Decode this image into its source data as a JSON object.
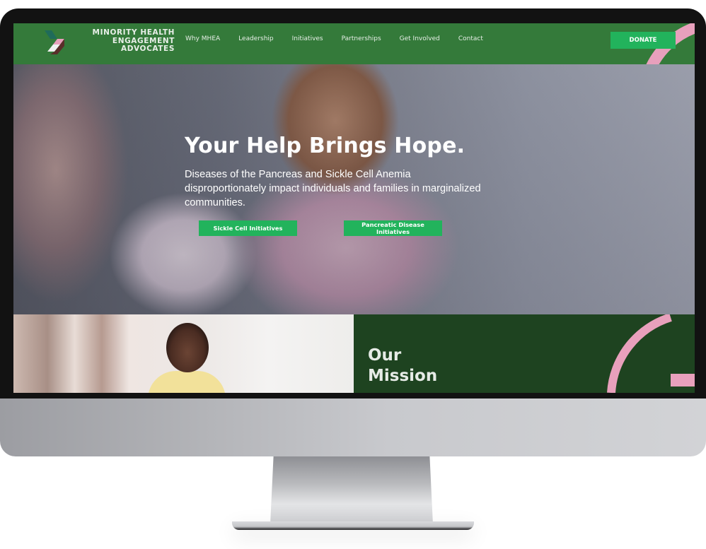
{
  "site": {
    "logo": {
      "line1": "MINORITY HEALTH",
      "line2": "ENGAGEMENT",
      "line3": "ADVOCATES"
    },
    "nav": {
      "links": [
        "Why MHEA",
        "Leadership",
        "Initiatives",
        "Partnerships",
        "Get Involved",
        "Contact"
      ],
      "donate_label": "DONATE"
    },
    "hero": {
      "title": "Your Help Brings Hope.",
      "subtitle": "Diseases of the Pancreas and Sickle Cell Anemia disproportionately impact individuals and families in marginalized communities.",
      "buttons": [
        "Sickle Cell Initiatives",
        "Pancreatic Disease Initiatives"
      ]
    },
    "mission": {
      "title_line1": "Our",
      "title_line2": "Mission"
    }
  },
  "colors": {
    "nav_green": "#347a3a",
    "button_green": "#22b35c",
    "mission_green": "#1e4320",
    "accent_pink": "#e8a0bc",
    "logo_teal": "#1f6b5a",
    "logo_brown": "#5a2e2a"
  }
}
